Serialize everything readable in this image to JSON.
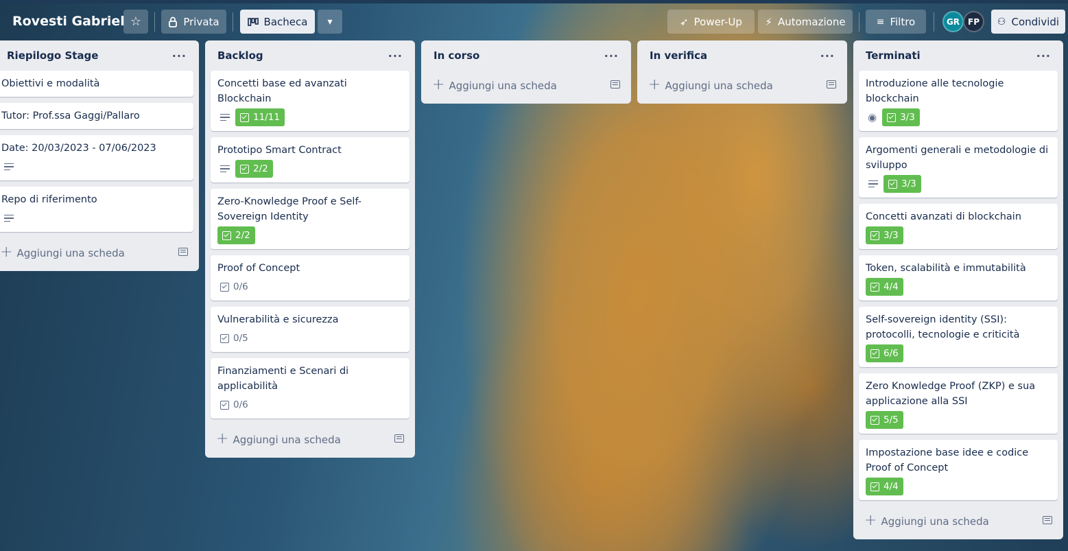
{
  "header": {
    "board_title": "Rovesti Gabriel",
    "visibility_label": "Privata",
    "view_label": "Bacheca",
    "powerup_label": "Power-Up",
    "automation_label": "Automazione",
    "filter_label": "Filtro",
    "share_label": "Condividi",
    "members": [
      {
        "initials": "GR",
        "color": "#0b8a9e"
      },
      {
        "initials": "FP",
        "color": "#1c2b41"
      }
    ]
  },
  "add_card_label": "Aggiungi una scheda",
  "lists": [
    {
      "title": "Riepilogo Stage",
      "cards": [
        {
          "title": "Obiettivi e modalità"
        },
        {
          "title": "Tutor: Prof.ssa Gaggi/Pallaro"
        },
        {
          "title": "Date: 20/03/2023 - 07/06/2023"
        },
        {
          "title": "Repo di riferimento"
        }
      ]
    },
    {
      "title": "Backlog",
      "cards": [
        {
          "title": "Concetti base ed avanzati Blockchain",
          "checklist": "11/11"
        },
        {
          "title": "Prototipo Smart Contract",
          "checklist": "2/2"
        },
        {
          "title": "Zero-Knowledge Proof e Self-Sovereign Identity",
          "checklist": "2/2"
        },
        {
          "title": "Proof of Concept",
          "checklist": "0/6"
        },
        {
          "title": "Vulnerabilità e sicurezza",
          "checklist": "0/5"
        },
        {
          "title": "Finanziamenti e Scenari di applicabilità",
          "checklist": "0/6"
        }
      ]
    },
    {
      "title": "In corso",
      "cards": []
    },
    {
      "title": "In verifica",
      "cards": []
    },
    {
      "title": "Terminati",
      "cards": [
        {
          "title": "Introduzione alle tecnologie blockchain",
          "checklist": "3/3"
        },
        {
          "title": "Argomenti generali e metodologie di sviluppo",
          "checklist": "3/3"
        },
        {
          "title": "Concetti avanzati di blockchain",
          "checklist": "3/3"
        },
        {
          "title": "Token, scalabilità e immutabilità",
          "checklist": "4/4"
        },
        {
          "title": "Self-sovereign identity (SSI): protocolli, tecnologie e criticità",
          "checklist": "6/6"
        },
        {
          "title": "Zero Knowledge Proof (ZKP) e sua applicazione alla SSI",
          "checklist": "5/5"
        },
        {
          "title": "Impostazione base idee e codice Proof of Concept",
          "checklist": "4/4"
        }
      ]
    }
  ]
}
